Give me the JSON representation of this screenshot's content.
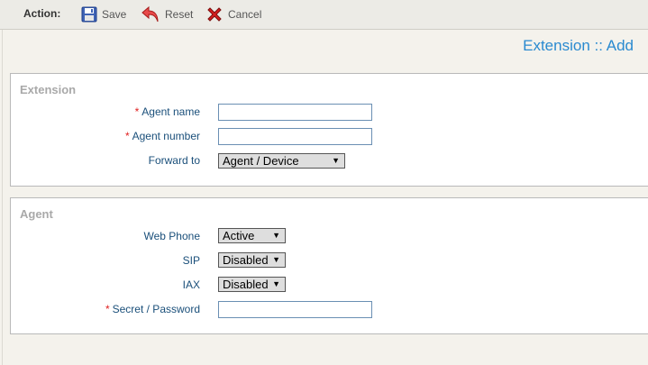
{
  "toolbar": {
    "action_label": "Action:",
    "save_label": "Save",
    "reset_label": "Reset",
    "cancel_label": "Cancel"
  },
  "page_title": "Extension :: Add",
  "extension_panel": {
    "legend": "Extension",
    "agent_name_label": "Agent name",
    "agent_number_label": "Agent number",
    "forward_to_label": "Forward to",
    "forward_to_value": "Agent / Device"
  },
  "agent_panel": {
    "legend": "Agent",
    "web_phone_label": "Web Phone",
    "web_phone_value": "Active",
    "sip_label": "SIP",
    "sip_value": "Disabled",
    "iax_label": "IAX",
    "iax_value": "Disabled",
    "secret_label": "Secret / Password"
  },
  "required_marker": "*",
  "colors": {
    "accent": "#2a8ad0",
    "label": "#1a4f7a",
    "required": "#e02020",
    "legend": "#a9a9a9"
  }
}
